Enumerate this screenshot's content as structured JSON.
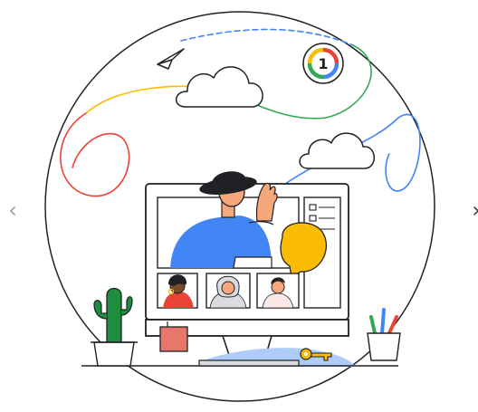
{
  "carousel": {
    "prev_arrow": "‹",
    "next_arrow": "›",
    "prev_icon": "chevron-left-icon",
    "next_icon": "chevron-right-icon"
  },
  "badge": {
    "number": "1",
    "icon": "google-one-logo",
    "colors": [
      "#4285F4",
      "#EA4335",
      "#FBBC04",
      "#34A853"
    ]
  },
  "colors": {
    "outline": "#202124",
    "accent_blue": "#4285F4",
    "accent_yellow": "#FBBC04",
    "accent_red": "#EA4335",
    "accent_green": "#34A853",
    "sky_blue": "#AECBFA",
    "plant_green": "#1E8E3E",
    "note_red": "#E8776B"
  }
}
